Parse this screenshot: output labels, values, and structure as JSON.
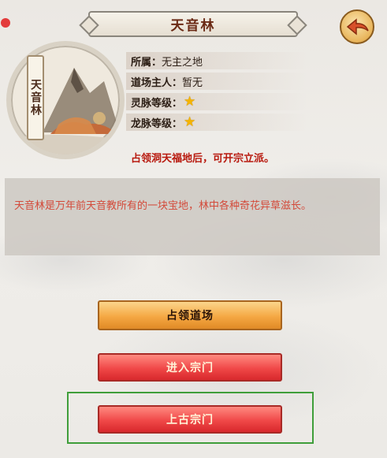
{
  "header": {
    "title": "天音林"
  },
  "portrait": {
    "name_scroll": "天音林"
  },
  "info": {
    "affiliation": {
      "label": "所属：",
      "value": "无主之地"
    },
    "owner": {
      "label": "道场主人：",
      "value": "暂无"
    },
    "spirit_vein": {
      "label": "灵脉等级：",
      "stars": 1
    },
    "dragon_vein": {
      "label": "龙脉等级：",
      "stars": 1
    },
    "notice": "占领洞天福地后，可开宗立派。"
  },
  "description": "天音林是万年前天音教所有的一块宝地，林中各种奇花异草滋长。",
  "buttons": {
    "occupy": "占领道场",
    "enter_sect": "进入宗门",
    "ancient_sect": "上古宗门"
  },
  "colors": {
    "notice": "#b8190e",
    "description": "#d34a3a",
    "occupy_button": "#f5a843",
    "red_button": "#f04848",
    "highlight_border": "#3f9e3a",
    "star": "#f5b400"
  },
  "icons": {
    "back": "back-arrow-icon",
    "star": "star-icon"
  }
}
